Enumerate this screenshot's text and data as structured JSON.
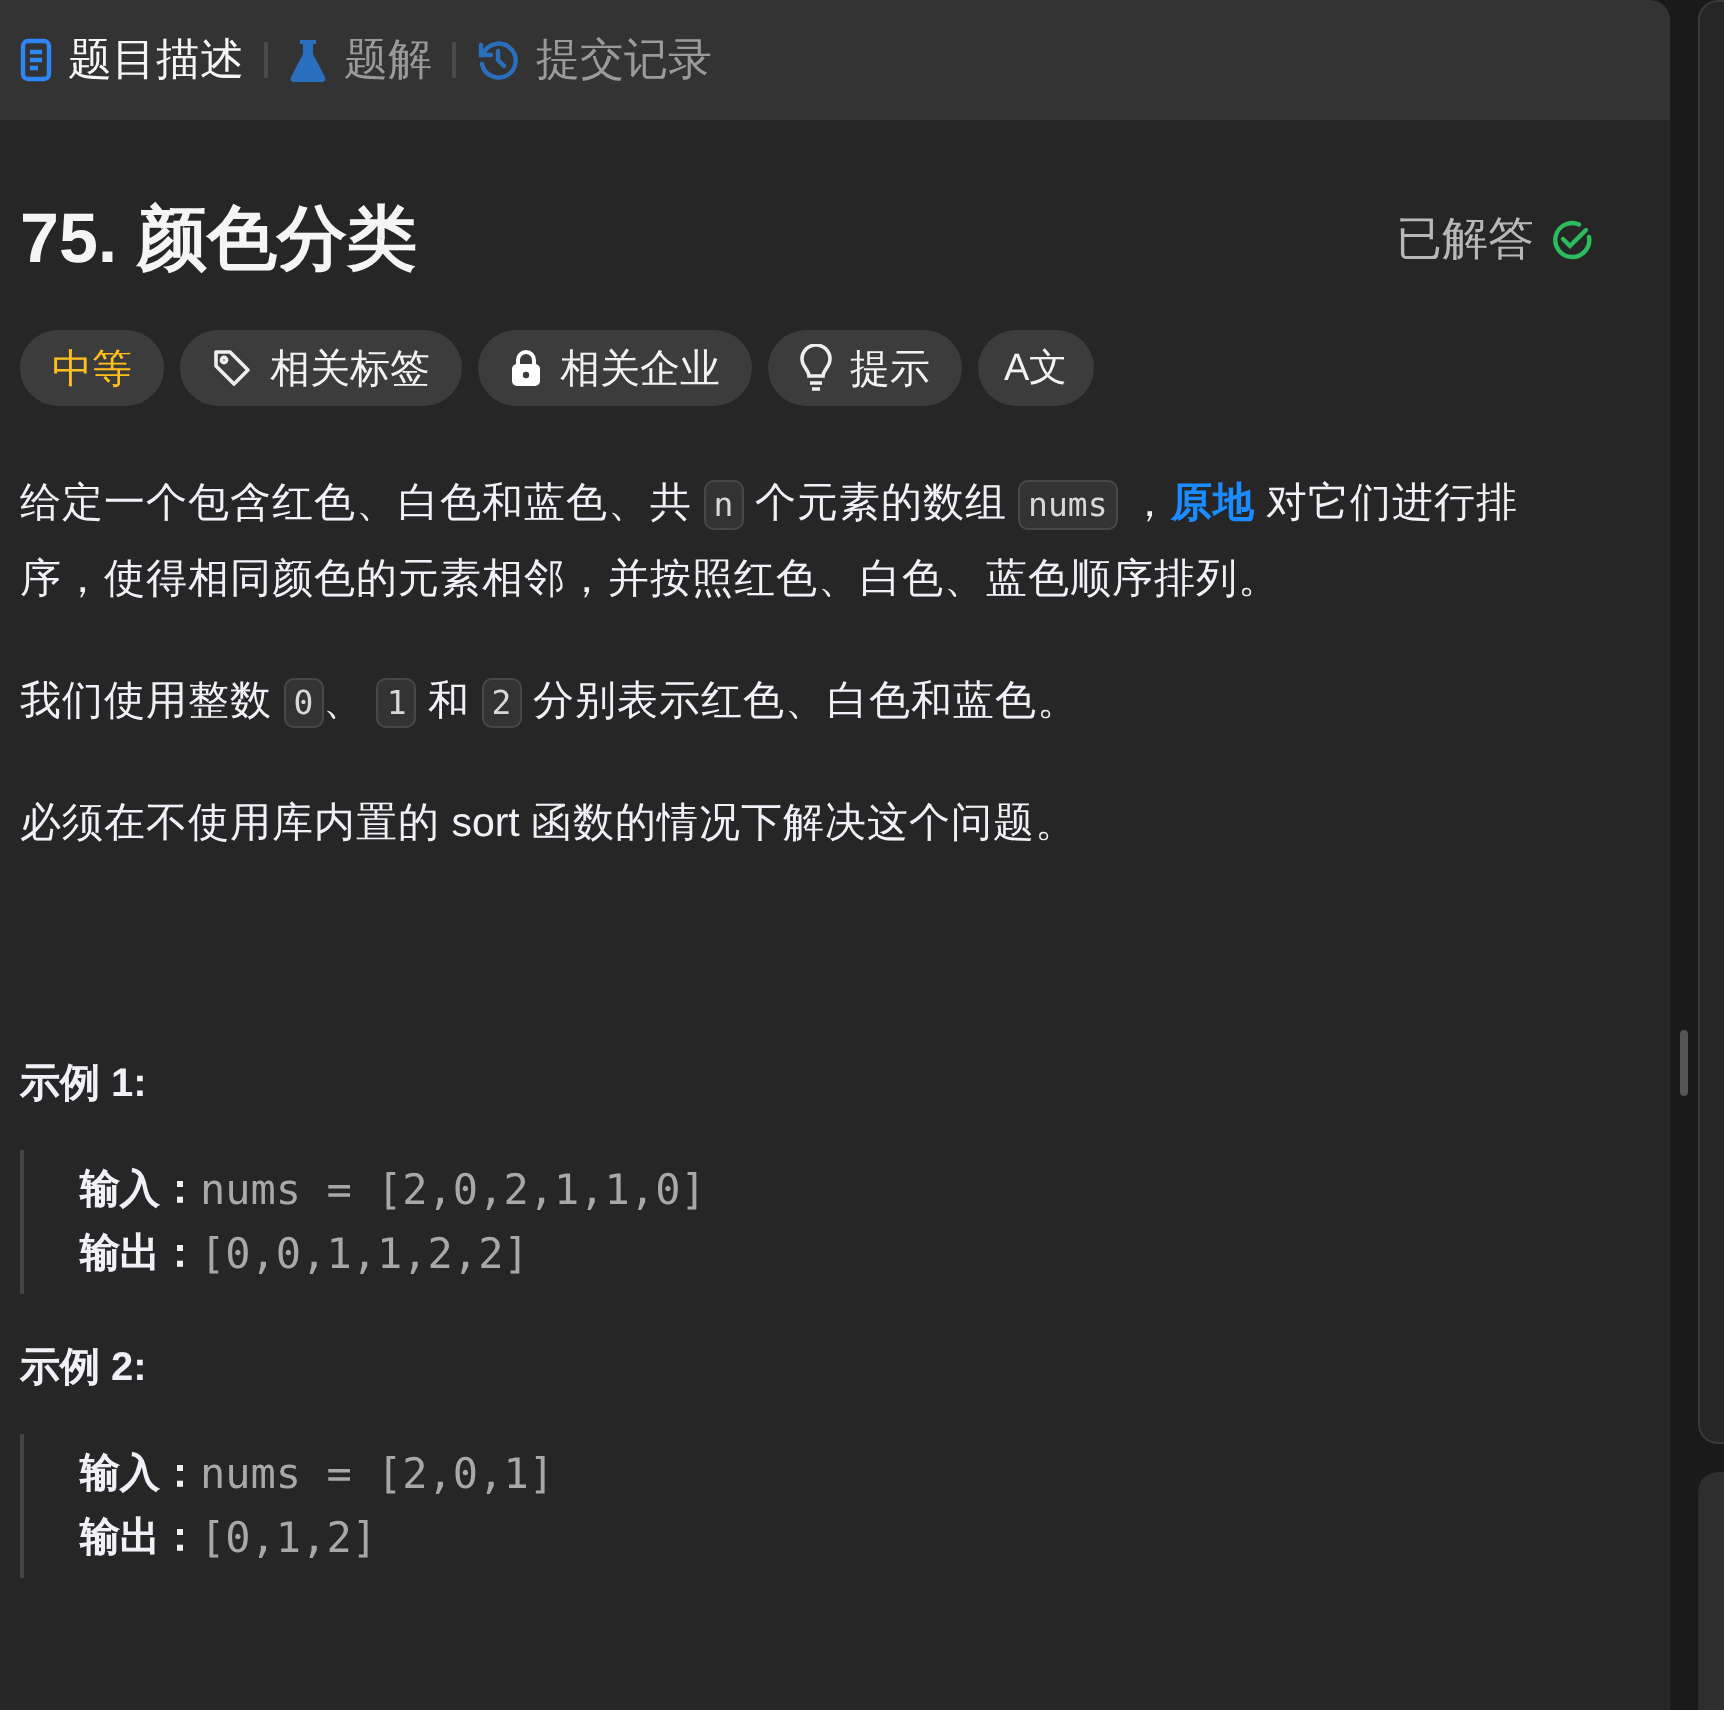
{
  "tabs": [
    {
      "label": "题目描述",
      "kind": "doc",
      "selected": true
    },
    {
      "label": "题解",
      "kind": "flask",
      "selected": false
    },
    {
      "label": "提交记录",
      "kind": "history",
      "selected": false
    }
  ],
  "problem": {
    "title": "75. 颜色分类",
    "status": "已解答",
    "solved": true
  },
  "tags": [
    {
      "label": "中等",
      "kind": "difficulty"
    },
    {
      "label": "相关标签",
      "kind": "tag"
    },
    {
      "label": "相关企业",
      "kind": "lock"
    },
    {
      "label": "提示",
      "kind": "bulb"
    },
    {
      "label": "A文",
      "kind": "translate"
    }
  ],
  "paragraphs": [
    [
      {
        "kind": "text",
        "text": "给定一个包含红色、白色和蓝色、共 "
      },
      {
        "kind": "code",
        "text": "n"
      },
      {
        "kind": "text",
        "text": " 个元素的数组 "
      },
      {
        "kind": "code",
        "text": "nums"
      },
      {
        "kind": "text",
        "text": " ，"
      },
      {
        "kind": "link",
        "text": "原地"
      },
      {
        "kind": "text",
        "text": " 对它们进行排序，使得相同颜色的元素相邻，并按照红色、白色、蓝色顺序排列。"
      }
    ],
    [
      {
        "kind": "text",
        "text": "我们使用整数 "
      },
      {
        "kind": "code",
        "text": "0"
      },
      {
        "kind": "text",
        "text": "、 "
      },
      {
        "kind": "code",
        "text": "1"
      },
      {
        "kind": "text",
        "text": " 和 "
      },
      {
        "kind": "code",
        "text": "2"
      },
      {
        "kind": "text",
        "text": " 分别表示红色、白色和蓝色。"
      }
    ],
    [
      {
        "kind": "text",
        "text": "必须在不使用库内置的 sort 函数的情况下解决这个问题。"
      }
    ]
  ],
  "examples": [
    {
      "heading": "示例 1:",
      "lines": [
        {
          "label": "输入：",
          "value": "nums = [2,0,2,1,1,0]"
        },
        {
          "label": "输出：",
          "value": "[0,0,1,1,2,2]"
        }
      ]
    },
    {
      "heading": "示例 2:",
      "lines": [
        {
          "label": "输入：",
          "value": "nums = [2,0,1]"
        },
        {
          "label": "输出：",
          "value": "[0,1,2]"
        }
      ]
    }
  ]
}
